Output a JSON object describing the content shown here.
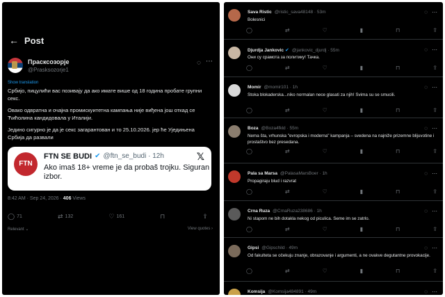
{
  "post": {
    "back_icon": "←",
    "title": "Post",
    "author_name": "Прасксозорје",
    "author_handle": "@Prasksozorje1",
    "translate_label": "Show translation",
    "body_lines": [
      "Србијо, пицулићи вас позивају да ако имате више од 18 година пробате групни секс.",
      "Овако одвратна и очајна промискуитетна кампања није виђена још откад се Ћићолина кандидовала у Италији.",
      "Једино сигурно је да је секс загарантован и то 25.10.2026. јер ће Уједињена Србија да развали"
    ],
    "quote": {
      "logo_text": "FTN",
      "name": "FTN SE BUDI",
      "handle": "@ftn_se_budi · 12h",
      "text": "Ako imaš 18+ vreme je da probaš trojku. Siguran izbor."
    },
    "meta_time": "8:42 AM · Sep 24, 2026 · ",
    "meta_views_count": "406",
    "meta_views_label": " Views",
    "actions": {
      "replies": "71",
      "reposts": "132",
      "likes": "161",
      "bookmark": "",
      "share": ""
    },
    "relevant_label": "Relevant ⌄",
    "view_quotes_label": "View quotes ›"
  },
  "comments": [
    {
      "name": "Sava Ristic",
      "badge": false,
      "handle": "@ristic_sava48148 · 53m",
      "text": "Bolesnici",
      "avatar_color": "#b5684a"
    },
    {
      "name": "Djurdja Jankovic",
      "badge": true,
      "handle": "@jankovic_djurdj · 55m",
      "text": "Они су срамота за политику! Тачка.",
      "avatar_color": "#c9b7a4"
    },
    {
      "name": "Momir",
      "badge": false,
      "handle": "@momir101 · 1h",
      "text": "Stoka blokaderska...niko normalan nece glasati za njih! Svima su se smucili.",
      "avatar_color": "#d9d9d9"
    },
    {
      "name": "Boza",
      "badge": false,
      "handle": "@Boza4fkld · 55m",
      "text": "Nema šta, vrhunska \"evropska i moderna\" kampanja – svedena na najniže prizemne blijuvotine i prostaštvo bez presedana.",
      "avatar_color": "#8a7d6e"
    },
    {
      "name": "Pala sa Marsa",
      "badge": false,
      "handle": "@PalasaMarsBoer · 1h",
      "text": "Propagiraju blud i razvrat",
      "avatar_color": "#c0392b"
    },
    {
      "name": "Crna Ruza",
      "badge": false,
      "handle": "@CrnaRuza238686 · 1h",
      "text": "Ni stapom ne bih dotakla nekog od piculica. Seme im se zatrlo.",
      "avatar_color": "#5a5a5a"
    },
    {
      "name": "Gipsi",
      "badge": false,
      "handle": "@Gipschild · 49m",
      "text": "Od fakulteta se očekuju znanje, obrazovanje i argumenti, a ne ovakve degutantne provokacije.",
      "avatar_color": "#7a6a5a"
    },
    {
      "name": "Komsija",
      "badge": false,
      "handle": "@Komsija484891 · 49m",
      "text": "",
      "avatar_color": "#c9a14a"
    }
  ]
}
